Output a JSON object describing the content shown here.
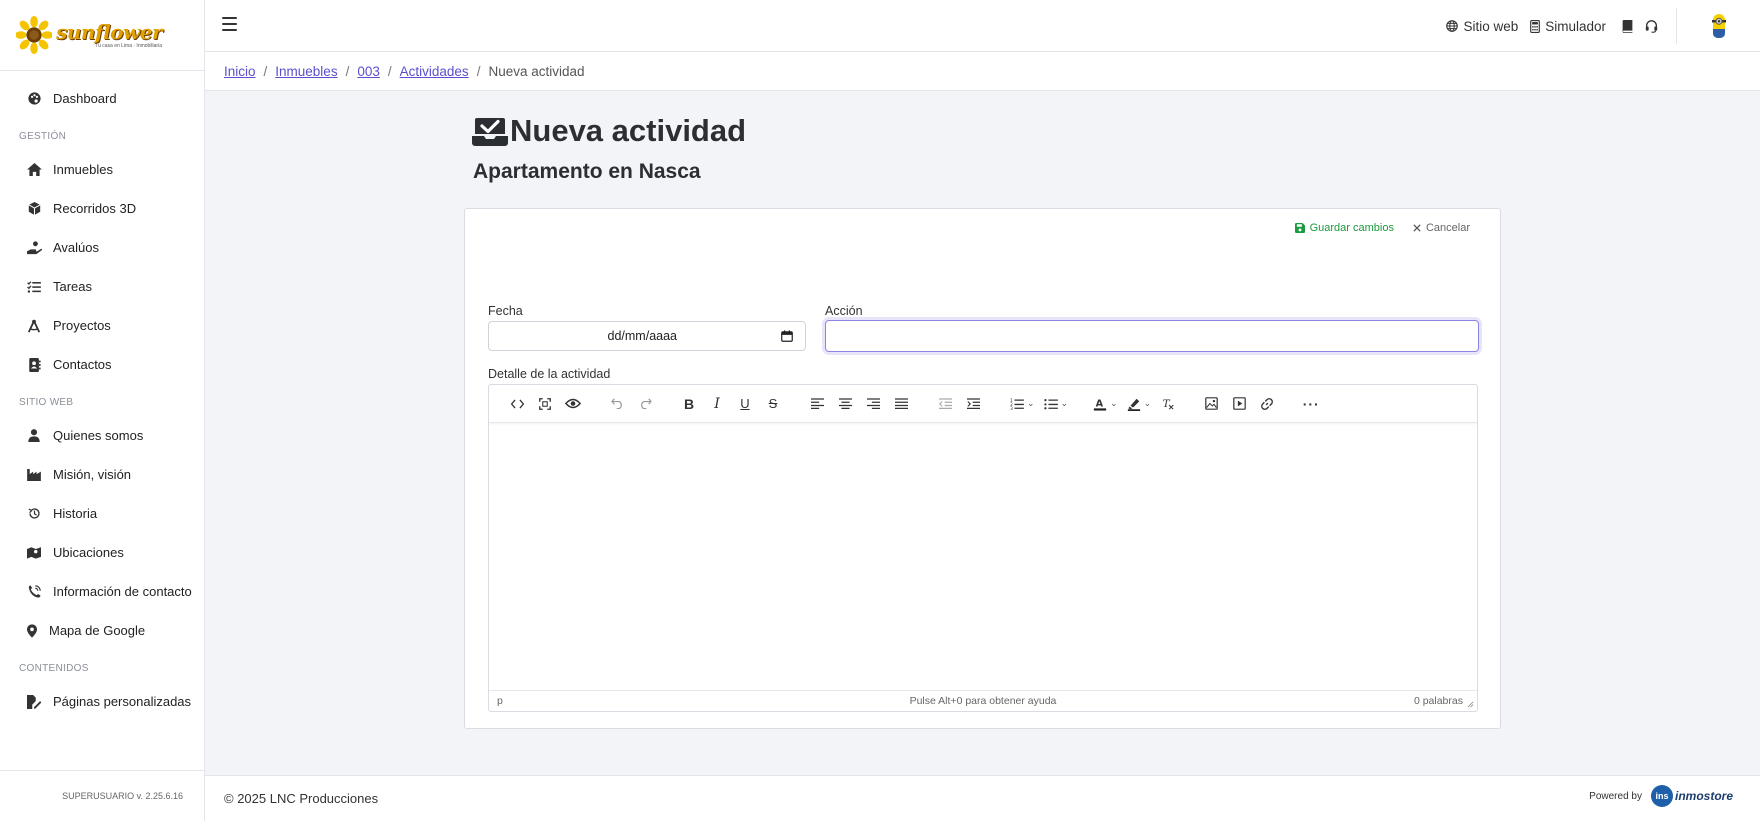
{
  "sidebar": {
    "logo": {
      "brand": "sunflower",
      "tagline": "Tu casa en Lima · Inmobiliaria"
    },
    "items": [
      {
        "label": "Dashboard",
        "icon": "palette-icon"
      },
      {
        "section": "GESTIÓN"
      },
      {
        "label": "Inmuebles",
        "icon": "home-icon"
      },
      {
        "label": "Recorridos 3D",
        "icon": "cube-icon"
      },
      {
        "label": "Avalúos",
        "icon": "hand-coin-icon"
      },
      {
        "label": "Tareas",
        "icon": "list-check-icon"
      },
      {
        "label": "Proyectos",
        "icon": "compass-icon"
      },
      {
        "label": "Contactos",
        "icon": "address-book-icon"
      },
      {
        "section": "SITIO WEB"
      },
      {
        "label": "Quienes somos",
        "icon": "user-icon"
      },
      {
        "label": "Misión, visión",
        "icon": "industry-icon"
      },
      {
        "label": "Historia",
        "icon": "history-icon"
      },
      {
        "label": "Ubicaciones",
        "icon": "map-location-icon"
      },
      {
        "label": "Información de contacto",
        "icon": "phone-icon"
      },
      {
        "label": "Mapa de Google",
        "icon": "map-pin-icon"
      },
      {
        "section": "CONTENIDOS"
      },
      {
        "label": "Páginas personalizadas",
        "icon": "file-edit-icon"
      }
    ],
    "footer": "SUPERUSUARIO v. 2.25.6.16"
  },
  "topbar": {
    "links": [
      {
        "label": "Sitio web",
        "icon": "globe-icon"
      },
      {
        "label": "Simulador",
        "icon": "calculator-icon"
      }
    ]
  },
  "breadcrumb": {
    "items": [
      "Inicio",
      "Inmuebles",
      "003",
      "Actividades"
    ],
    "current": "Nueva actividad"
  },
  "page": {
    "title": "Nueva actividad",
    "subtitle": "Apartamento en Nasca"
  },
  "form": {
    "save_label": "Guardar cambios",
    "cancel_label": "Cancelar",
    "fecha_label": "Fecha",
    "fecha_value": "dd/mm/aaaa",
    "accion_label": "Acción",
    "accion_value": "",
    "detalle_label": "Detalle de la actividad"
  },
  "editor": {
    "status_path": "p",
    "status_help": "Pulse Alt+0 para obtener ayuda",
    "word_count": "0 palabras"
  },
  "footer": {
    "copyright": "© 2025 LNC Producciones",
    "powered_by": "Powered by",
    "powered_brand": "inmostore"
  },
  "colors": {
    "accent": "#5a4fcf",
    "save_green": "#1c9a3e",
    "logo_yellow": "#f5c400"
  }
}
